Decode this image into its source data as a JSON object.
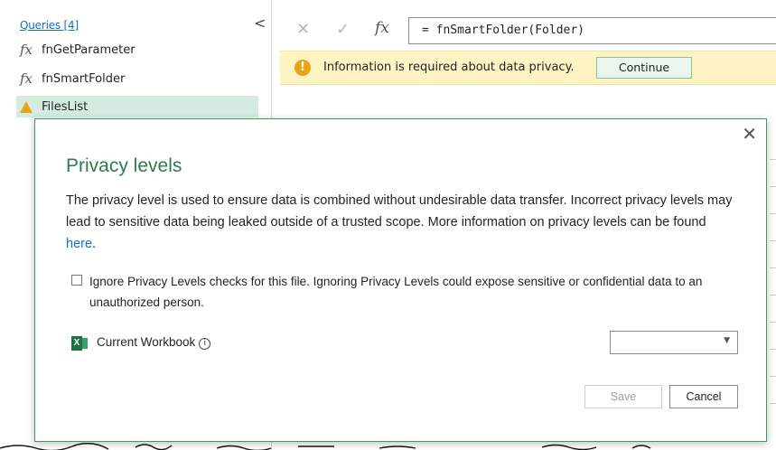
{
  "query_pane": {
    "header": "Queries [4]",
    "collapse_glyph": "<",
    "items": [
      {
        "label": "fnGetParameter",
        "icon": "fx-icon"
      },
      {
        "label": "fnSmartFolder",
        "icon": "fx-icon"
      },
      {
        "label": "FilesList",
        "icon": "warning-icon"
      }
    ]
  },
  "formula_bar": {
    "cancel_glyph": "✕",
    "commit_glyph": "✓",
    "fx_label": "fx",
    "formula": "= fnSmartFolder(Folder)"
  },
  "info_bar": {
    "icon_glyph": "!",
    "message": "Information is required about data privacy.",
    "continue_label": "Continue"
  },
  "dialog": {
    "close_glyph": "✕",
    "title": "Privacy levels",
    "description": "The privacy level is used to ensure data is combined without undesirable data transfer. Incorrect privacy levels may lead to sensitive data being leaked outside of a trusted scope. More information on privacy levels can be found",
    "link_text": "here",
    "period": ".",
    "ignore_text": "Ignore Privacy Levels checks for this file. Ignoring Privacy Levels could expose sensitive or confidential data to an unauthorized person.",
    "ignore_checked": false,
    "workbook_icon_letter": "X",
    "workbook_label": "Current Workbook",
    "info_glyph": "i",
    "privacy_select_value": "",
    "select_caret": "▼",
    "save_label": "Save",
    "cancel_label": "Cancel"
  },
  "colors": {
    "accent": "#2f7a4d",
    "selected_row": "#d4ece0",
    "warning": "#e8a317",
    "info_bar_bg": "#fdf3c3",
    "link": "#0f6fc6"
  }
}
